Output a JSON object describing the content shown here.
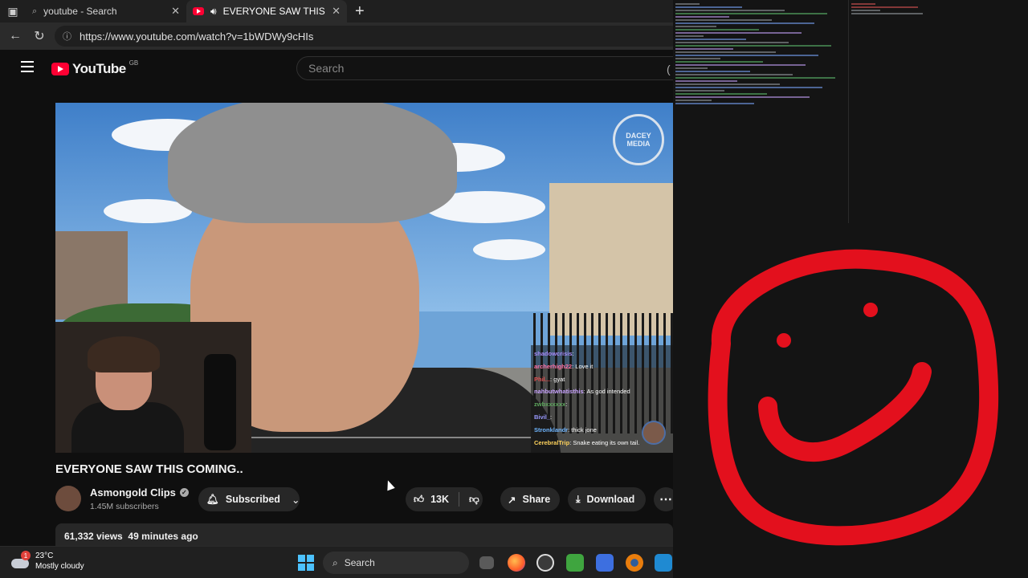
{
  "browser": {
    "tabs": [
      {
        "title": "youtube - Search",
        "active": false
      },
      {
        "title": "EVERYONE SAW THIS COMIN",
        "active": true
      }
    ],
    "new_tab": "+",
    "url": "https://www.youtube.com/watch?v=1bWDWy9cHIs"
  },
  "youtube": {
    "logo_text": "YouTube",
    "region": "GB",
    "search_placeholder": "Search"
  },
  "video": {
    "watermark_top": "DACEY",
    "watermark_bottom": "MEDIA",
    "chat": [
      {
        "user": "shadowcrisis",
        "msg": "",
        "color": "#a78bfa"
      },
      {
        "user": "archerhigh22",
        "msg": "Love it",
        "color": "#ff6fa0"
      },
      {
        "user": "Phil...",
        "msg": "gyat",
        "color": "#e05050"
      },
      {
        "user": "nahbutwhatisthis",
        "msg": "As god intended",
        "color": "#c9a4ff"
      },
      {
        "user": "zwbxxxxxx",
        "msg": "",
        "color": "#5ea85e"
      },
      {
        "user": "Bivil_",
        "msg": "",
        "color": "#9a9aff"
      },
      {
        "user": "Stronklandr",
        "msg": "thick jone",
        "color": "#6fb6ff"
      },
      {
        "user": "CerebralTrip",
        "msg": "Snake eating its own tail.",
        "color": "#ffd35c"
      }
    ]
  },
  "meta": {
    "title": "EVERYONE SAW THIS COMING..",
    "channel": "Asmongold Clips",
    "subscribers": "1.45M subscribers",
    "subscribed_label": "Subscribed",
    "likes": "13K",
    "share_label": "Share",
    "download_label": "Download",
    "views_line": "61,332 views  49 minutes ago"
  },
  "taskbar": {
    "weather_badge": "1",
    "temperature": "23°C",
    "condition": "Mostly cloudy",
    "search_label": "Search"
  },
  "colors": {
    "accent_red": "#ff0033",
    "drawing_red": "#e3101d",
    "background": "#0f0f0f"
  }
}
